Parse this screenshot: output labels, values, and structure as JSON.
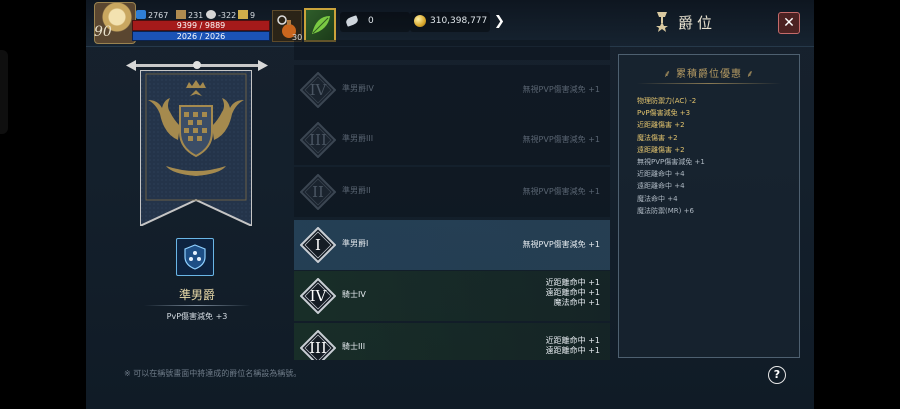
{
  "hud": {
    "level": "90",
    "stat1": "2767",
    "stat2": "231",
    "stat3": "-322",
    "stat4": "9",
    "hp": "9399 / 9889",
    "mp": "2026 / 2026",
    "buff_count": "30",
    "feather_count": "0",
    "gold": "310,398,777"
  },
  "header": {
    "title": "爵位"
  },
  "rank_card": {
    "name": "準男爵",
    "bonus": "PvP傷害減免 +3"
  },
  "ranks": [
    {
      "roman": "IV",
      "name": "準男爵IV",
      "desc": [
        "無視PVP傷害減免 +1"
      ],
      "state": "locked"
    },
    {
      "roman": "III",
      "name": "準男爵III",
      "desc": [
        "無視PVP傷害減免 +1"
      ],
      "state": "locked"
    },
    {
      "roman": "II",
      "name": "準男爵II",
      "desc": [
        "無視PVP傷害減免 +1"
      ],
      "state": "locked"
    },
    {
      "roman": "I",
      "name": "準男爵I",
      "desc": [
        "無視PVP傷害減免 +1"
      ],
      "state": "current"
    },
    {
      "roman": "IV",
      "name": "騎士IV",
      "desc": [
        "近距離命中 +1",
        "遠距離命中 +1",
        "魔法命中 +1"
      ],
      "state": "next"
    },
    {
      "roman": "III",
      "name": "騎士III",
      "desc": [
        "近距離命中 +1",
        "遠距離命中 +1"
      ],
      "state": "next"
    }
  ],
  "panel": {
    "title": "累積爵位優惠",
    "bonuses": [
      {
        "text": "物理防禦力(AC) -2",
        "tone": "gold"
      },
      {
        "text": "PvP傷害減免 +3",
        "tone": "gold"
      },
      {
        "text": "近距離傷害 +2",
        "tone": "gold"
      },
      {
        "text": "魔法傷害 +2",
        "tone": "gold"
      },
      {
        "text": "遠距離傷害 +2",
        "tone": "gold"
      },
      {
        "text": "無視PVP傷害減免 +1",
        "tone": "grey"
      },
      {
        "text": "近距離命中 +4",
        "tone": "grey"
      },
      {
        "text": "遠距離命中 +4",
        "tone": "grey"
      },
      {
        "text": "魔法命中 +4",
        "tone": "grey"
      },
      {
        "text": "魔法防禦(MR) +6",
        "tone": "grey"
      }
    ]
  },
  "footer": {
    "note": "※ 可以在稱號畫面中將達成的爵位名稱設為稱號。"
  },
  "colors": {
    "gold": "#e3c46e",
    "hp": "#a51a1a",
    "mp": "#1b53b6",
    "accent": "#6ab6e6"
  }
}
